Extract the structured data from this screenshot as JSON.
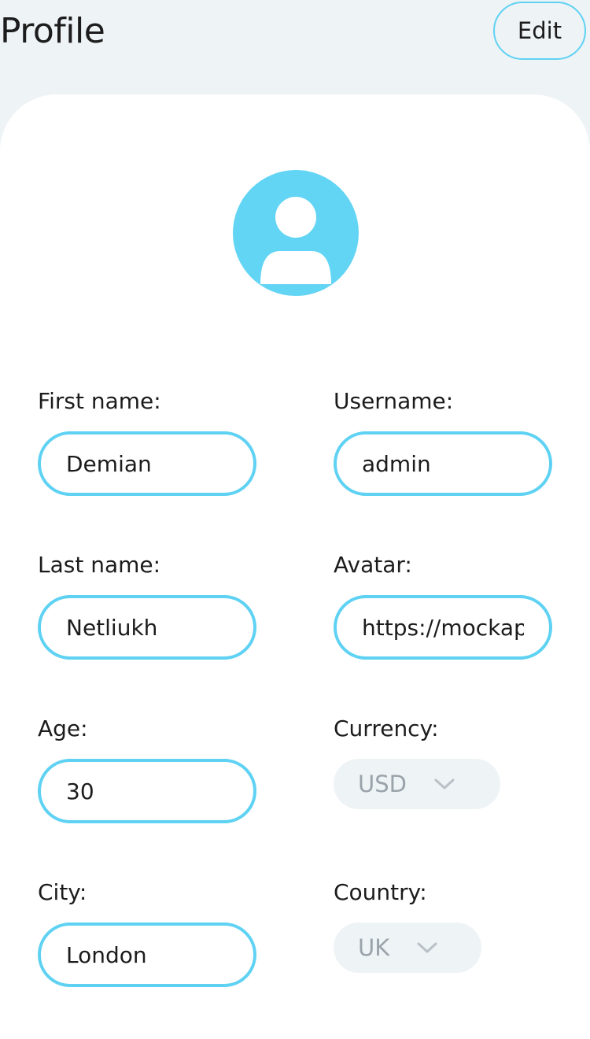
{
  "header": {
    "title": "Profile",
    "edit_label": "Edit"
  },
  "avatar": {
    "icon": "user-avatar-icon",
    "color": "#62d4f4"
  },
  "form": {
    "first_name": {
      "label": "First name:",
      "value": "Demian"
    },
    "username": {
      "label": "Username:",
      "value": "admin"
    },
    "last_name": {
      "label": "Last name:",
      "value": "Netliukh"
    },
    "avatar": {
      "label": "Avatar:",
      "value": "https://mockap"
    },
    "age": {
      "label": "Age:",
      "value": "30"
    },
    "currency": {
      "label": "Currency:",
      "selected": "USD"
    },
    "city": {
      "label": "City:",
      "value": "London"
    },
    "country": {
      "label": "Country:",
      "selected": "UK"
    }
  },
  "colors": {
    "accent": "#5fd2f3",
    "background": "#eef3f6",
    "card": "#ffffff",
    "disabled_text": "#9aa3aa"
  }
}
